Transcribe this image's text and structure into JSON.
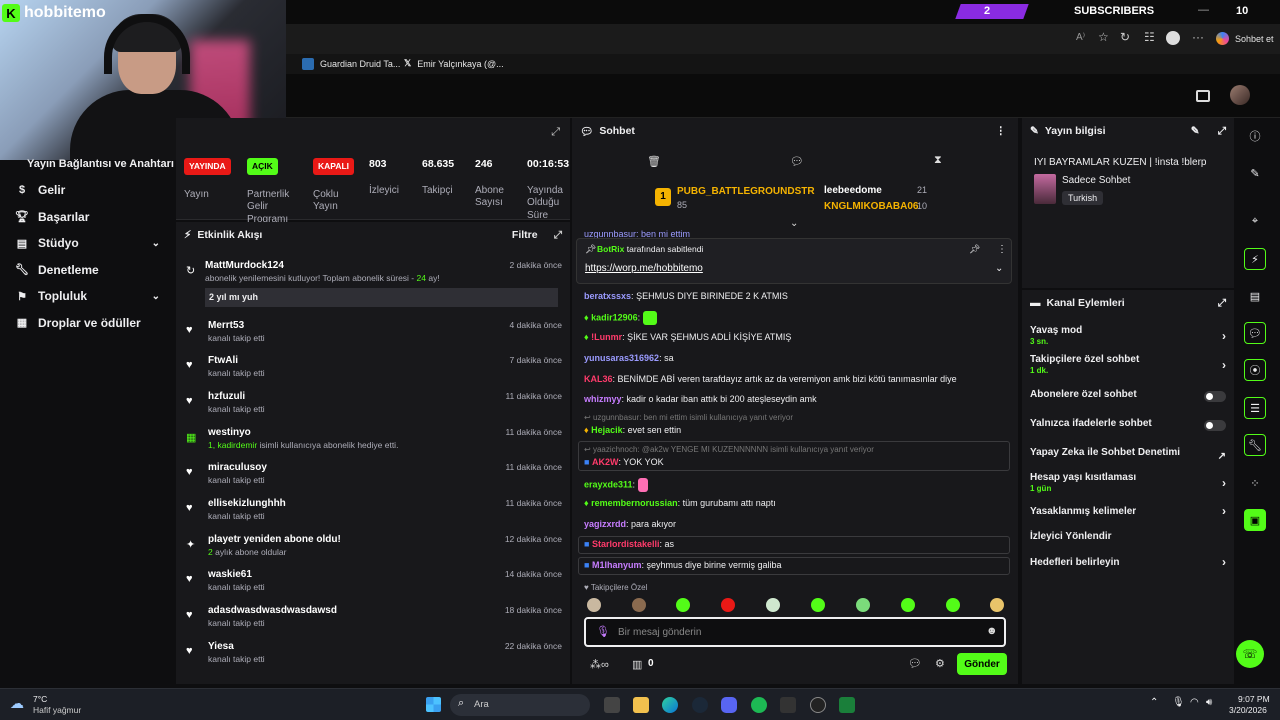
{
  "topbar": {
    "subs_count": "2",
    "subs_label": "SUBSCRIBERS",
    "right_num": "10"
  },
  "browser": {
    "sohbet_et": "Sohbet et"
  },
  "tabs": [
    {
      "label": "Guardian Druid Ta..."
    },
    {
      "label": "Emir Yalçınkaya (@..."
    }
  ],
  "webcam": {
    "brand": "hobbitemo"
  },
  "leftnav": {
    "header": "Yayın Bağlantısı ve Anahtarı",
    "items": [
      {
        "label": "Gelir"
      },
      {
        "label": "Başarılar"
      },
      {
        "label": "Stüdyo"
      },
      {
        "label": "Denetleme"
      },
      {
        "label": "Topluluk"
      },
      {
        "label": "Droplar ve ödüller"
      }
    ]
  },
  "stats": {
    "yayin_pill": "YAYINDA",
    "yayin_label": "Yayın",
    "partner_pill": "AÇIK",
    "partner_label": "Partnerlik Gelir Programı",
    "coklu_pill": "KAPALI",
    "coklu_label": "Çoklu Yayın",
    "izleyici": "803",
    "izleyici_label": "İzleyici",
    "takipci": "68.635",
    "takipci_label": "Takipçi",
    "abone": "246",
    "abone_label": "Abone Sayısı",
    "sure": "00:16:53",
    "sure_label": "Yayında Olduğu Süre"
  },
  "activity": {
    "title": "Etkinlik Akışı",
    "filter": "Filtre",
    "items": [
      {
        "name": "MattMurdock124",
        "sub_a": "abonelik yenilemesini kutluyor! Toplam abonelik süresi -",
        "sub_b": "24",
        "sub_c": "ay!",
        "time": "2 dakika önce",
        "message": "2 yıl mı yuh"
      },
      {
        "name": "Merrt53",
        "sub": "kanalı takip etti",
        "time": "4 dakika önce"
      },
      {
        "name": "FtwAli",
        "sub": "kanalı takip etti",
        "time": "7 dakika önce"
      },
      {
        "name": "hzfuzuli",
        "sub": "kanalı takip etti",
        "time": "11 dakika önce"
      },
      {
        "name": "westinyo",
        "sub_a": "1,",
        "sub_b": "kadirdemir",
        "sub_c": "isimli kullanıcıya abonelik hediye etti.",
        "time": "11 dakika önce"
      },
      {
        "name": "miraculusoy",
        "sub": "kanalı takip etti",
        "time": "11 dakika önce"
      },
      {
        "name": "ellisekizlunghhh",
        "sub": "kanalı takip etti",
        "time": "11 dakika önce"
      },
      {
        "name": "playetr yeniden abone oldu!",
        "sub_a": "2",
        "sub_c": "aylık abone oldular",
        "time": "12 dakika önce"
      },
      {
        "name": "waskie61",
        "sub": "kanalı takip etti",
        "time": "14 dakika önce"
      },
      {
        "name": "adasdwasdwasdwasdawsd",
        "sub": "kanalı takip etti",
        "time": "18 dakika önce"
      },
      {
        "name": "Yiesa",
        "sub": "kanalı takip etti",
        "time": "22 dakika önce"
      }
    ]
  },
  "chat": {
    "title": "Sohbet",
    "leader1_name": "PUBG_BATTLEGROUNDSTR",
    "leader1_count": "85",
    "leader2_name": "leebeedome",
    "leader2_count": "21",
    "leader3_name": "KNGLMIKOBABA06",
    "leader3_count": "10",
    "partial_line": "uzgunnbasur: ben mi ettim",
    "pinned_by": "BotRix",
    "pinned_text": "tarafından sabitlendi",
    "pinned_link": "https://worp.me/hobbitemo",
    "messages": [
      {
        "user": "beratxssxs",
        "text": "ŞEHMUS DIYE BIRINEDE 2 K ATMIS",
        "color": "#9b9bff"
      },
      {
        "user": "kadir12906",
        "text": "",
        "color": "#53fc18"
      },
      {
        "user": "!Lunmr",
        "text": "ŞİKE VAR ŞEHMUS ADLİ KİŞİYE ATMIŞ",
        "color": "#ff3b6b"
      },
      {
        "user": "yunusaras316962",
        "text": "sa",
        "color": "#9b9bff"
      },
      {
        "user": "KAL36",
        "text": "BENİMDE ABİ veren tarafdayız artık az da veremiyon amk bizi kötü tanımasınlar diye",
        "color": "#ff3b6b"
      },
      {
        "user": "whizmyy",
        "text": "kadir o kadar iban attık bi 200 ateşleseydin amk",
        "color": "#c77dff"
      },
      {
        "reply": "uzgunnbasur: ben mi ettim isimli kullanıcıya yanıt veriyor"
      },
      {
        "user": "Hejacik",
        "text": "evet sen ettin",
        "color": "#53fc18"
      },
      {
        "reply": "yaazichnoch: @ak2w YENGE MI KUZENNNNNN isimli kullanıcıya yanıt veriyor"
      },
      {
        "user": "AK2W",
        "text": "YOK YOK",
        "color": "#ff3b6b"
      },
      {
        "user": "erayxde311",
        "text": "",
        "color": "#53fc18"
      },
      {
        "user": "remembernorussian",
        "text": "tüm gurubamı attı naptı",
        "color": "#53fc18"
      },
      {
        "user": "yagizxrdd",
        "text": "para akıyor",
        "color": "#c77dff"
      },
      {
        "user": "Starlordistakelli",
        "text": "as",
        "color": "#ff3b6b"
      },
      {
        "user": "M1lhanyum",
        "text": "şeyhmus diye birine vermiş galiba",
        "color": "#c77dff"
      }
    ],
    "takipcilere_ozel": "Takipçilere Özel",
    "input_placeholder": "Bir mesaj gönderin",
    "bottom_count": "0",
    "send_label": "Gönder"
  },
  "streaminfo": {
    "title": "Yayın bilgisi",
    "stream_title": "IYI BAYRAMLAR KUZEN | !insta !blerp",
    "category": "Sadece Sohbet",
    "language": "Turkish"
  },
  "chanactions": {
    "title": "Kanal Eylemleri",
    "rows": [
      {
        "label": "Yavaş mod",
        "sub": "3 sn."
      },
      {
        "label": "Takipçilere özel sohbet",
        "sub": "1 dk."
      },
      {
        "label": "Abonelere özel sohbet"
      },
      {
        "label": "Yalnızca ifadelerle sohbet"
      },
      {
        "label": "Yapay Zeka ile Sohbet Denetimi"
      },
      {
        "label": "Hesap yaşı kısıtlaması",
        "sub": "1 gün"
      },
      {
        "label": "Yasaklanmış kelimeler"
      },
      {
        "label": "İzleyici Yönlendir"
      },
      {
        "label": "Hedefleri belirleyin"
      }
    ]
  },
  "taskbar": {
    "temp": "7°C",
    "weather": "Hafif yağmur",
    "search": "Ara",
    "time": "9:07 PM",
    "date": "3/20/2026"
  },
  "colors": {
    "accent": "#53fc18",
    "panel": "#18181b",
    "bg": "#0e0e10"
  }
}
